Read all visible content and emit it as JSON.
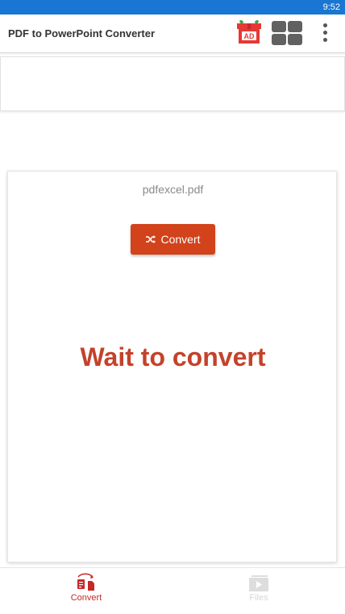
{
  "status_bar": {
    "time": "9:52"
  },
  "app_bar": {
    "title": "PDF to PowerPoint Converter",
    "ad_label": "AD",
    "icons": [
      "ad-gift-icon",
      "grid-icon",
      "more-vert-icon"
    ]
  },
  "main": {
    "file_name": "pdfexcel.pdf",
    "convert_button_label": "Convert",
    "status_message": "Wait to convert"
  },
  "bottom_nav": {
    "tabs": [
      {
        "label": "Convert",
        "active": true,
        "icon": "convert-files-icon"
      },
      {
        "label": "Files",
        "active": false,
        "icon": "files-play-icon"
      }
    ]
  },
  "colors": {
    "status_bar": "#1976d2",
    "accent": "#d2431b",
    "status_text": "#c4422a",
    "active_tab": "#c62828",
    "inactive_tab": "#d6d6d6"
  }
}
